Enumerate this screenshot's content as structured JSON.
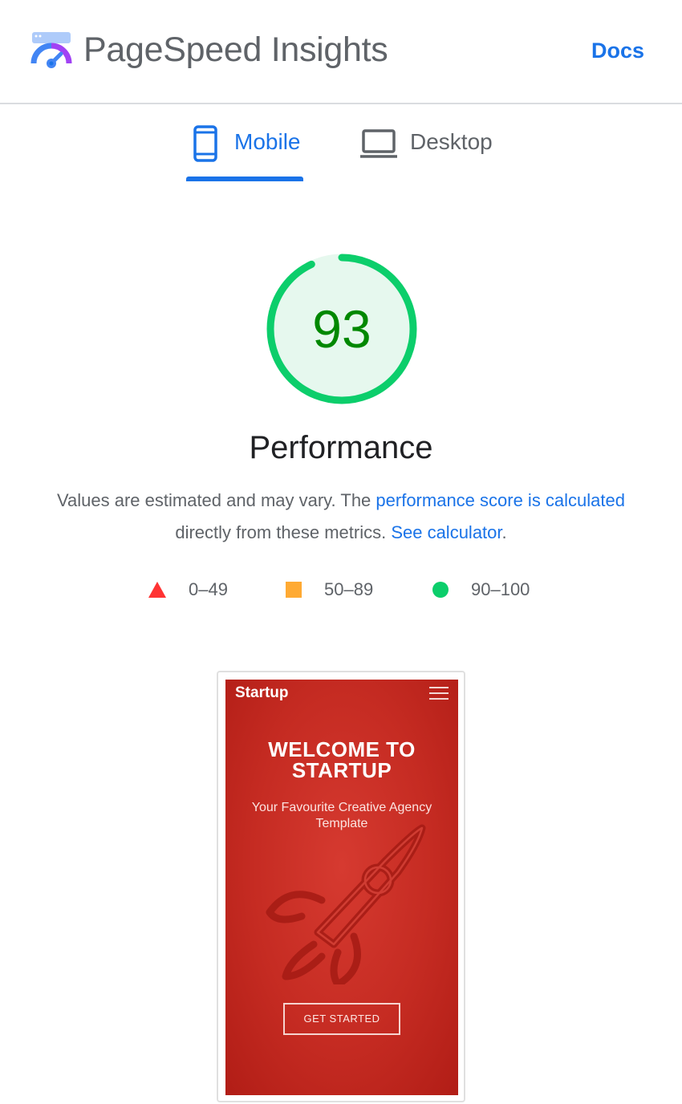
{
  "header": {
    "title": "PageSpeed Insights",
    "docs_label": "Docs",
    "logo_icon": "pagespeed-logo-icon"
  },
  "tabs": [
    {
      "label": "Mobile",
      "icon": "smartphone-icon",
      "selected": true
    },
    {
      "label": "Desktop",
      "icon": "laptop-icon",
      "selected": false
    }
  ],
  "score": {
    "value": "93",
    "fraction": 0.93,
    "label": "Performance",
    "color": "#0cce6b",
    "text_color": "#008800"
  },
  "description": {
    "text_before": "Values are estimated and may vary. The ",
    "link_score": "performance score is calculated",
    "text_middle": " directly from these metrics. ",
    "link_calculator": "See calculator",
    "text_after": "."
  },
  "legend": [
    {
      "range": "0–49",
      "shape": "triangle",
      "color": "#ff3333"
    },
    {
      "range": "50–89",
      "shape": "square",
      "color": "#ffaa33"
    },
    {
      "range": "90–100",
      "shape": "circle",
      "color": "#0cce6b"
    }
  ],
  "screenshot": {
    "brand": "Startup",
    "hero_title_line1": "WELCOME TO",
    "hero_title_line2": "STARTUP",
    "hero_subtitle": "Your Favourite Creative Agency Template",
    "cta_label": "GET STARTED",
    "background_color": "#c52b22"
  }
}
